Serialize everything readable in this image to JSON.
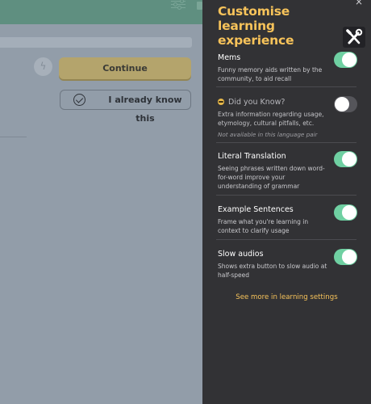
{
  "background": {
    "continue_label": "Continue",
    "already_know_label": "I already know this"
  },
  "panel": {
    "close_label": "×",
    "title": "Customise learning experience",
    "tools_icon": "wrench-screwdriver-icon",
    "settings": [
      {
        "name": "Mems",
        "description": "Funny memory aids written by the community, to aid recall",
        "enabled": true
      },
      {
        "name": "Did you Know?",
        "description": "Extra information regarding usage, etymology, cultural pitfalls, etc.",
        "note": "Not available in this language pair",
        "enabled": false
      },
      {
        "name": "Literal Translation",
        "description": "Seeing phrases written down word-for-word improve your understanding of grammar",
        "enabled": true
      },
      {
        "name": "Example Sentences",
        "description": "Frame what you're learning in context to clarify usage",
        "enabled": true
      },
      {
        "name": "Slow audios",
        "description": "Shows extra button to slow audio at half-speed",
        "enabled": true
      }
    ],
    "more_link": "See more in learning settings"
  },
  "colors": {
    "accent": "#f7c35a",
    "toggle_on": "#6fd0a2",
    "panel_bg": "#323235",
    "continue_bg": "#b4a46c"
  }
}
